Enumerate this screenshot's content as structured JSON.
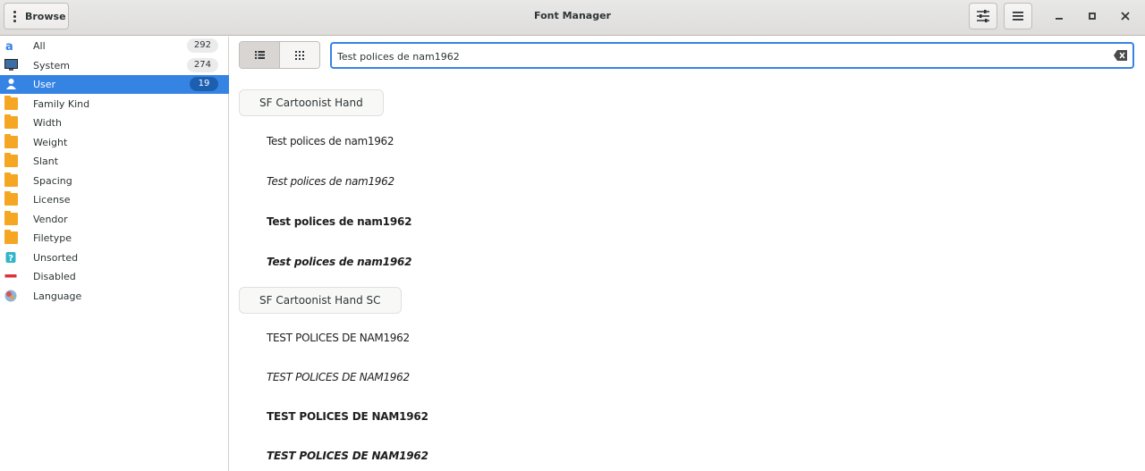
{
  "header": {
    "browse_label": "Browse",
    "title": "Font Manager"
  },
  "sidebar": {
    "items": [
      {
        "label": "All",
        "count": "292",
        "icon": "all-fonts-icon"
      },
      {
        "label": "System",
        "count": "274",
        "icon": "monitor-icon"
      },
      {
        "label": "User",
        "count": "19",
        "icon": "user-icon",
        "selected": true
      },
      {
        "label": "Family Kind",
        "icon": "folder-icon"
      },
      {
        "label": "Width",
        "icon": "folder-icon"
      },
      {
        "label": "Weight",
        "icon": "folder-icon"
      },
      {
        "label": "Slant",
        "icon": "folder-icon"
      },
      {
        "label": "Spacing",
        "icon": "folder-icon"
      },
      {
        "label": "License",
        "icon": "folder-icon"
      },
      {
        "label": "Vendor",
        "icon": "folder-icon"
      },
      {
        "label": "Filetype",
        "icon": "folder-icon"
      },
      {
        "label": "Unsorted",
        "icon": "unsorted-icon"
      },
      {
        "label": "Disabled",
        "icon": "disabled-icon"
      },
      {
        "label": "Language",
        "icon": "language-icon"
      }
    ]
  },
  "search": {
    "value": "Test polices de nam1962"
  },
  "families": [
    {
      "name": "SF Cartoonist Hand",
      "samples": [
        "Test polices de nam1962",
        "Test polices de nam1962",
        "Test polices de nam1962",
        "Test polices de nam1962"
      ]
    },
    {
      "name": "SF Cartoonist Hand SC",
      "samples": [
        "TEST POLICES DE NAM1962",
        "TEST POLICES DE NAM1962",
        "TEST POLICES DE NAM1962",
        "TEST POLICES DE NAM1962"
      ]
    }
  ],
  "colors": {
    "accent": "#3584e4",
    "folder": "#f5a623"
  }
}
